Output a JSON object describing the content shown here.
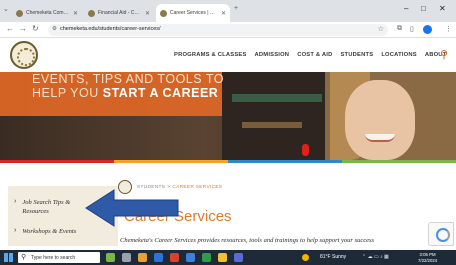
{
  "browser": {
    "tabs": [
      {
        "title": "Chemeketa Community Colleg",
        "active": false
      },
      {
        "title": "Financial Aid - Chemeketa Com",
        "active": false
      },
      {
        "title": "Career Services | Chemeketa C",
        "active": true
      }
    ],
    "new_tab": "+",
    "url": "chemeketa.edu/students/career-services/",
    "controls": {
      "back": "←",
      "forward": "→",
      "reload": "↻",
      "minimize": "–",
      "maximize": "□",
      "close": "✕",
      "collapse": "⌄"
    }
  },
  "site": {
    "nav": [
      "PROGRAMS & CLASSES",
      "ADMISSION",
      "COST & AID",
      "STUDENTS",
      "LOCATIONS",
      "ABOUT"
    ],
    "accent_color": "#e07a2a"
  },
  "hero": {
    "line1": "EVENTS, TIPS AND TOOLS TO",
    "line2_prefix": "HELP YOU ",
    "line2_bold": "START A CAREER"
  },
  "breadcrumb": {
    "parent": "STUDENTS",
    "separator": ">",
    "current": "CAREER SERVICES"
  },
  "page": {
    "title": "Career Services",
    "intro": "Chemeketa's Career Services provides resources, tools and trainings to help support your success"
  },
  "sidebar": {
    "items": [
      {
        "label_line1": "Job Search Tips &",
        "label_line2": "Resources"
      },
      {
        "label_line1": "Workshops & Events",
        "label_line2": ""
      }
    ]
  },
  "annotation": {
    "arrow_color": "#2e5aa7"
  },
  "taskbar": {
    "search_placeholder": "Type here to search",
    "weather": "81°F Sunny",
    "time": "3:05 PM",
    "date": "7/22/2024"
  }
}
